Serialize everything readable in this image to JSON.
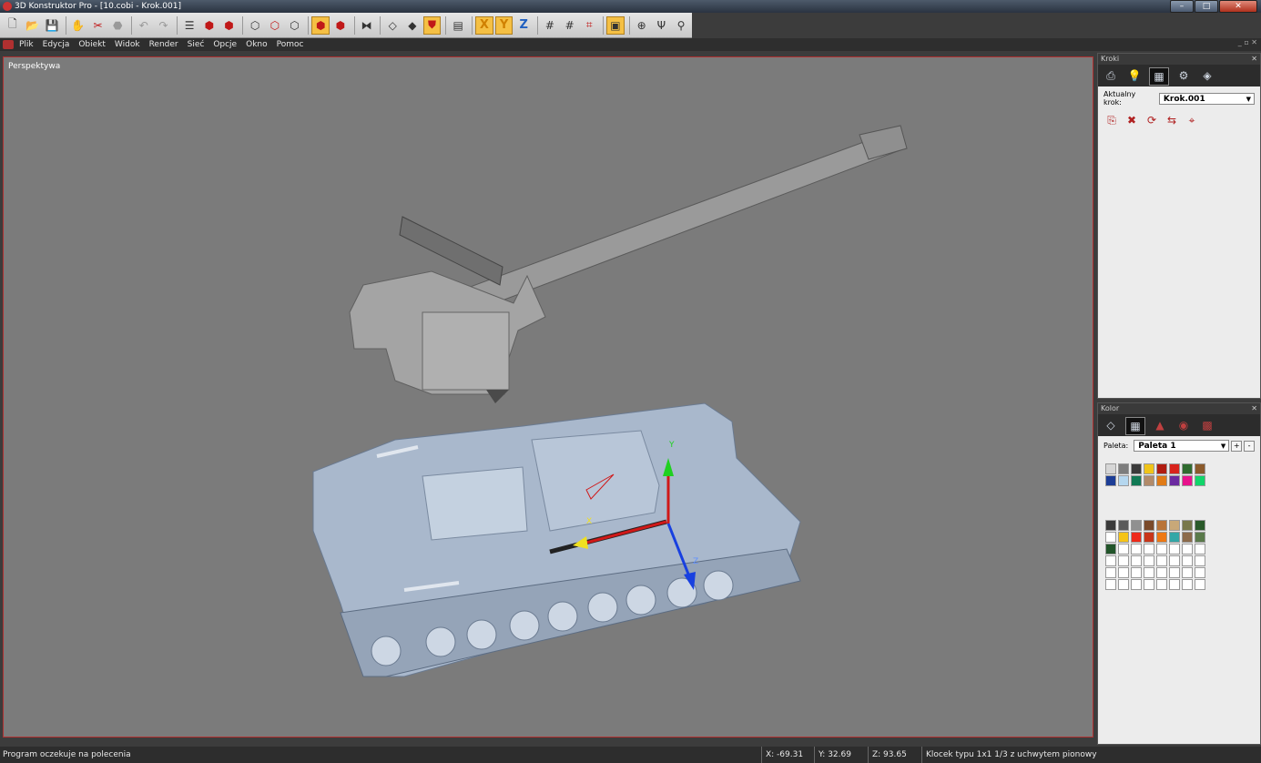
{
  "window": {
    "title": "3D Konstruktor Pro - [10.cobi - Krok.001]",
    "buttons": {
      "minimize": "–",
      "maximize": "□",
      "close": "✕"
    }
  },
  "toolbar": {
    "icons": [
      "new-file-icon",
      "open-folder-icon",
      "save-icon",
      "pick-brick-icon",
      "delete-brick-icon",
      "ghost-brick-icon",
      "undo-icon",
      "redo-icon",
      "step-list-icon",
      "red-brick-icon",
      "red-brick-move-icon",
      "grey-brick-icon",
      "grey-brick-rotate-icon",
      "grey-brick-duplicate-icon",
      "active-brick-icon",
      "red-brick-copy-icon",
      "mirror-icon",
      "wireframe-cube-icon",
      "solid-cube-icon",
      "red-shield-cube-icon",
      "layers-icon",
      "grid-small-icon",
      "grid-medium-icon",
      "grid-snap-icon",
      "window-frame-icon",
      "move-target-icon",
      "magnet-icon",
      "key-icon"
    ],
    "axis_x": "X",
    "axis_y": "Y",
    "axis_z": "Z"
  },
  "menu": {
    "items": [
      "Plik",
      "Edycja",
      "Obiekt",
      "Widok",
      "Render",
      "Sieć",
      "Opcje",
      "Okno",
      "Pomoc"
    ],
    "mdi_controls": "_ ▫ ✕"
  },
  "viewport": {
    "label": "Perspektywa",
    "gizmo": {
      "x_label": "X",
      "y_label": "Y",
      "z_label": "Z"
    }
  },
  "kroki_panel": {
    "title": "Kroki",
    "close": "✕",
    "tabs": [
      "layers-print-icon",
      "lightbulb-icon",
      "numbered-grid-icon",
      "bricks-icon",
      "step-box-icon"
    ],
    "current_step_label": "Aktualny krok:",
    "current_step_value": "Krok.001",
    "dropdown_arrow": "▼",
    "actions": [
      "step-export-icon",
      "step-delete-icon",
      "step-refresh-icon",
      "step-move-icon",
      "step-target-icon"
    ]
  },
  "kolor_panel": {
    "title": "Kolor",
    "close": "✕",
    "tabs": [
      "cube-outline-icon",
      "color-grid-icon",
      "bricks-stack-icon",
      "color-dot-icon",
      "pattern-icon"
    ],
    "palette_label": "Paleta:",
    "palette_value": "Paleta 1",
    "add": "+",
    "remove": "-",
    "dropdown_arrow": "▼",
    "colors_top": [
      "#d6d6d6",
      "#7d7d7d",
      "#3a3a3a",
      "#f0c419",
      "#b01c10",
      "#d8231c",
      "#2f6b2f",
      "#8b5a2b",
      "#1c3d96",
      "#b5d7ef",
      "#117a55",
      "#b28b6a",
      "#e07b16",
      "#6b2aa0",
      "#e8128c",
      "#12d56a",
      "#d9a8a0"
    ],
    "colors_bottom": [
      "#3a3a3a",
      "#5a5a5a",
      "#909090",
      "#7a4a2a",
      "#b8743a",
      "#c8a878",
      "#78784a",
      "#2a5a2a",
      "#ffffff",
      "#f5c419",
      "#ee2a1a",
      "#c8361a",
      "#ee7814",
      "#33a7a7",
      "#8c6a4a",
      "#5a7a4a",
      "#22552a",
      "#ffffff"
    ]
  },
  "status": {
    "message": "Program oczekuje na polecenia",
    "x": "X: -69.31",
    "y": "Y: 32.69",
    "z": "Z: 93.65",
    "info": "Klocek typu 1x1 1/3 z uchwytem pionowy"
  }
}
